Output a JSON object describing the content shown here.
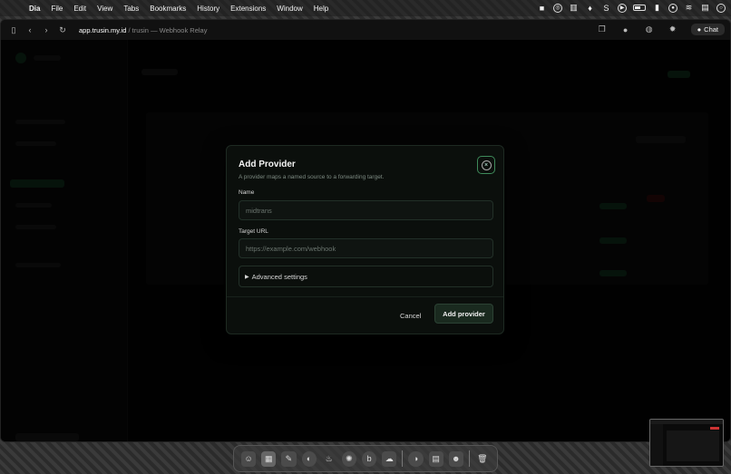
{
  "menubar": {
    "app_name": "Dia",
    "items": [
      "File",
      "Edit",
      "View",
      "Tabs",
      "Bookmarks",
      "History",
      "Extensions",
      "Window",
      "Help"
    ]
  },
  "browser": {
    "url_host": "app.trusin.my.id",
    "url_rest": " / trusin — Webhook Relay",
    "chat_label": "Chat"
  },
  "modal": {
    "title": "Add Provider",
    "subtitle": "A provider maps a named source to a forwarding target.",
    "name_label": "Name",
    "name_placeholder": "midtrans",
    "target_label": "Target URL",
    "target_placeholder": "https://example.com/webhook",
    "advanced_label": "Advanced settings",
    "cancel_label": "Cancel",
    "submit_label": "Add provider"
  },
  "colors": {
    "accent_green": "#3e8a5a",
    "modal_bg": "#0b0f0c"
  }
}
